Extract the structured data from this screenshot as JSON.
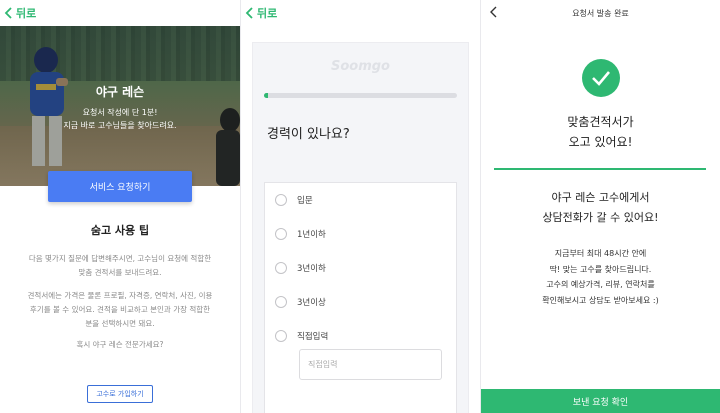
{
  "panel1": {
    "back_label": "뒤로",
    "hero_title": "야구 레슨",
    "hero_sub_line1": "요청서 작성에 단 1분!",
    "hero_sub_line2": "지금 바로 고수님들을 찾아드려요.",
    "cta_label": "서비스 요청하기",
    "tips_title": "숨고 사용 팁",
    "tip1_line1": "다음 몇가지 질문에 답변해주시면, 고수님이 요청에 적합한",
    "tip1_line2": "맞춤 견적서를 보내드려요.",
    "tip2_line1": "견적서에는 가격은 물론 프로필, 자격증, 연락처, 사진, 이용",
    "tip2_line2": "후기를 볼 수 있어요. 견적을 비교하고 본인과 가장 적합한",
    "tip2_line3": "분을 선택하시면 돼요.",
    "tip3": "혹시 야구 레슨 전문가세요?",
    "join_label": "고수로 가입하기"
  },
  "panel2": {
    "back_label": "뒤로",
    "brand": "Soomgo",
    "progress_fraction": 0.02,
    "question": "경력이 있나요?",
    "options": [
      "입문",
      "1년이하",
      "3년이하",
      "3년이상",
      "직접입력"
    ],
    "direct_placeholder": "직접입력"
  },
  "panel3": {
    "header_title": "요청서 발송 완료",
    "headline_line1": "맞춤견적서가",
    "headline_line2": "오고 있어요!",
    "sub_line1": "야구 레슨 고수에게서",
    "sub_line2": "상담전화가 갈 수 있어요!",
    "body_line1": "지금부터 최대 48시간 안에",
    "body_line2": "딱! 맞는 고수를 찾아드립니다.",
    "body_line3": "고수의 예상가격, 리뷰, 연락처를",
    "body_line4": "확인해보시고 상담도 받아보세요 :)",
    "confirm_label": "보낸 요청 확인"
  },
  "colors": {
    "accent_green": "#2eb872",
    "cta_blue": "#4a7cf3",
    "join_blue": "#3a6fd8"
  },
  "icons": {
    "back": "chevron-left-icon",
    "check": "checkmark-icon"
  }
}
